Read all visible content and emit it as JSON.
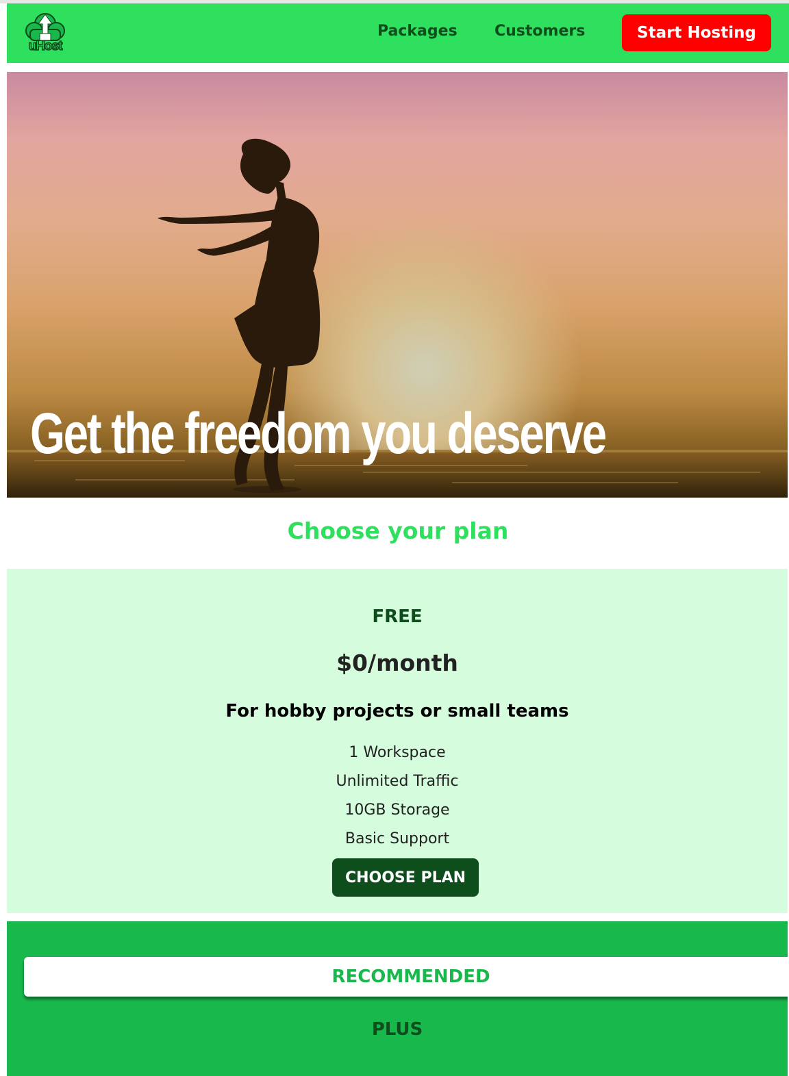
{
  "header": {
    "logo_text": "uHost",
    "nav": [
      {
        "label": "Packages"
      },
      {
        "label": "Customers"
      }
    ],
    "cta_label": "Start Hosting"
  },
  "hero": {
    "headline": "Get the freedom you deserve"
  },
  "plans_section": {
    "title": "Choose your plan",
    "plans": [
      {
        "name": "FREE",
        "price": "$0/month",
        "description": "For hobby projects or small teams",
        "features": [
          "1 Workspace",
          "Unlimited Traffic",
          "10GB Storage",
          "Basic Support"
        ],
        "button_label": "CHOOSE PLAN"
      },
      {
        "badge": "RECOMMENDED",
        "name": "PLUS"
      }
    ]
  },
  "colors": {
    "brand_green": "#2ee05e",
    "dark_green": "#0e4d1c",
    "cta_red": "#ff0000",
    "free_plan_bg": "#d5fcdc",
    "plus_plan_bg": "#19b84c"
  },
  "icons": {
    "logo": "cloud-upload-icon"
  }
}
